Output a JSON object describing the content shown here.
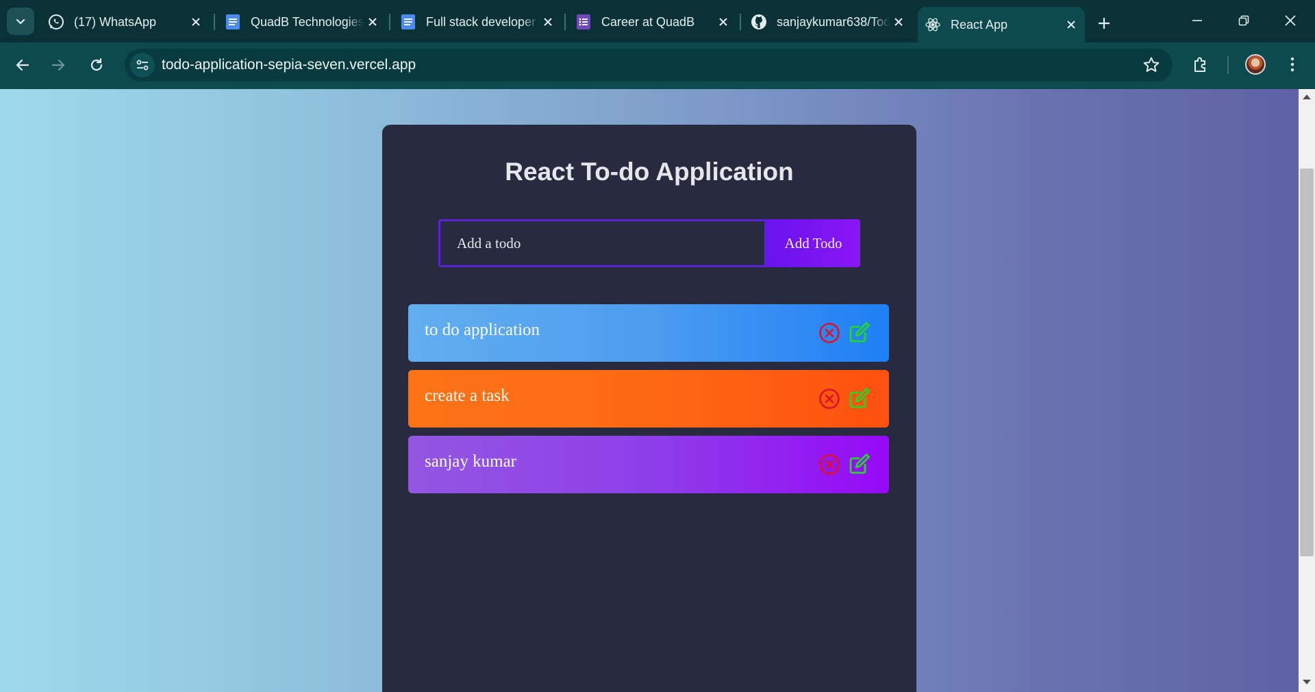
{
  "browser": {
    "tabs": [
      {
        "title": "(17) WhatsApp",
        "favicon": "whatsapp-icon"
      },
      {
        "title": "QuadB Technologies",
        "favicon": "docs-icon"
      },
      {
        "title": "Full stack developer",
        "favicon": "docs-icon"
      },
      {
        "title": "Career at QuadB",
        "favicon": "forms-icon"
      },
      {
        "title": "sanjaykumar638/Todo",
        "favicon": "github-icon"
      },
      {
        "title": "React App",
        "favicon": "react-icon",
        "active": true
      }
    ],
    "url": "todo-application-sepia-seven.vercel.app"
  },
  "app": {
    "title": "React To-do Application",
    "input_placeholder": "Add a todo",
    "add_button_label": "Add Todo",
    "todos": [
      {
        "text": "to do application"
      },
      {
        "text": "create a task"
      },
      {
        "text": "sanjay kumar"
      }
    ]
  },
  "colors": {
    "card_bg": "#282b40",
    "input_border": "#5b21d6",
    "add_button": "#7a14f0",
    "delete_icon": "#e0102a",
    "edit_icon": "#22d62a",
    "todo_blue": "#4d9df0",
    "todo_orange": "#fe6913",
    "todo_purple": "#8e3fe8"
  }
}
